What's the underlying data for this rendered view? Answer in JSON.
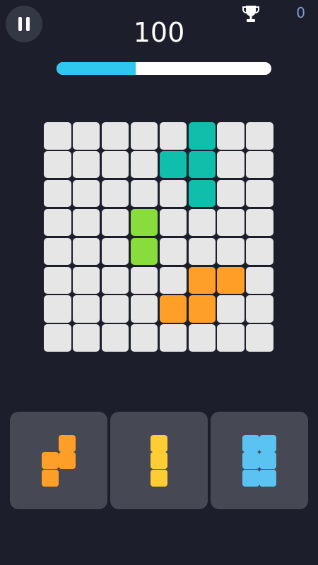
{
  "hud": {
    "pause_icon": "pause-icon",
    "score": "100",
    "trophy_icon": "trophy-icon",
    "best_score": "0",
    "progress_fraction": 0.37
  },
  "colors": {
    "background": "#1c1f2b",
    "empty_cell": "#e6e6e6",
    "teal": "#0fbfab",
    "green": "#88dc3c",
    "orange": "#ff9f27",
    "yellow": "#fecd33",
    "light_blue": "#5bc3f2",
    "progress": "#2fc6ef",
    "tray": "#464954"
  },
  "board": {
    "rows": 8,
    "cols": 8,
    "filled": [
      {
        "row": 0,
        "col": 5,
        "color": "teal"
      },
      {
        "row": 1,
        "col": 4,
        "color": "teal"
      },
      {
        "row": 1,
        "col": 5,
        "color": "teal"
      },
      {
        "row": 2,
        "col": 5,
        "color": "teal"
      },
      {
        "row": 3,
        "col": 3,
        "color": "green"
      },
      {
        "row": 4,
        "col": 3,
        "color": "green"
      },
      {
        "row": 5,
        "col": 5,
        "color": "orange"
      },
      {
        "row": 5,
        "col": 6,
        "color": "orange"
      },
      {
        "row": 6,
        "col": 4,
        "color": "orange"
      },
      {
        "row": 6,
        "col": 5,
        "color": "orange"
      }
    ]
  },
  "pieces": [
    {
      "name": "orange-s-piece",
      "color": "orange",
      "cells": [
        [
          0,
          1
        ],
        [
          1,
          0
        ],
        [
          1,
          1
        ],
        [
          2,
          0
        ]
      ]
    },
    {
      "name": "yellow-i-piece",
      "color": "yellow",
      "cells": [
        [
          0,
          0
        ],
        [
          1,
          0
        ],
        [
          2,
          0
        ]
      ]
    },
    {
      "name": "blue-block-piece",
      "color": "light_blue",
      "cells": [
        [
          0,
          0
        ],
        [
          0,
          1
        ],
        [
          1,
          0
        ],
        [
          1,
          1
        ],
        [
          2,
          0
        ],
        [
          2,
          1
        ]
      ]
    }
  ]
}
